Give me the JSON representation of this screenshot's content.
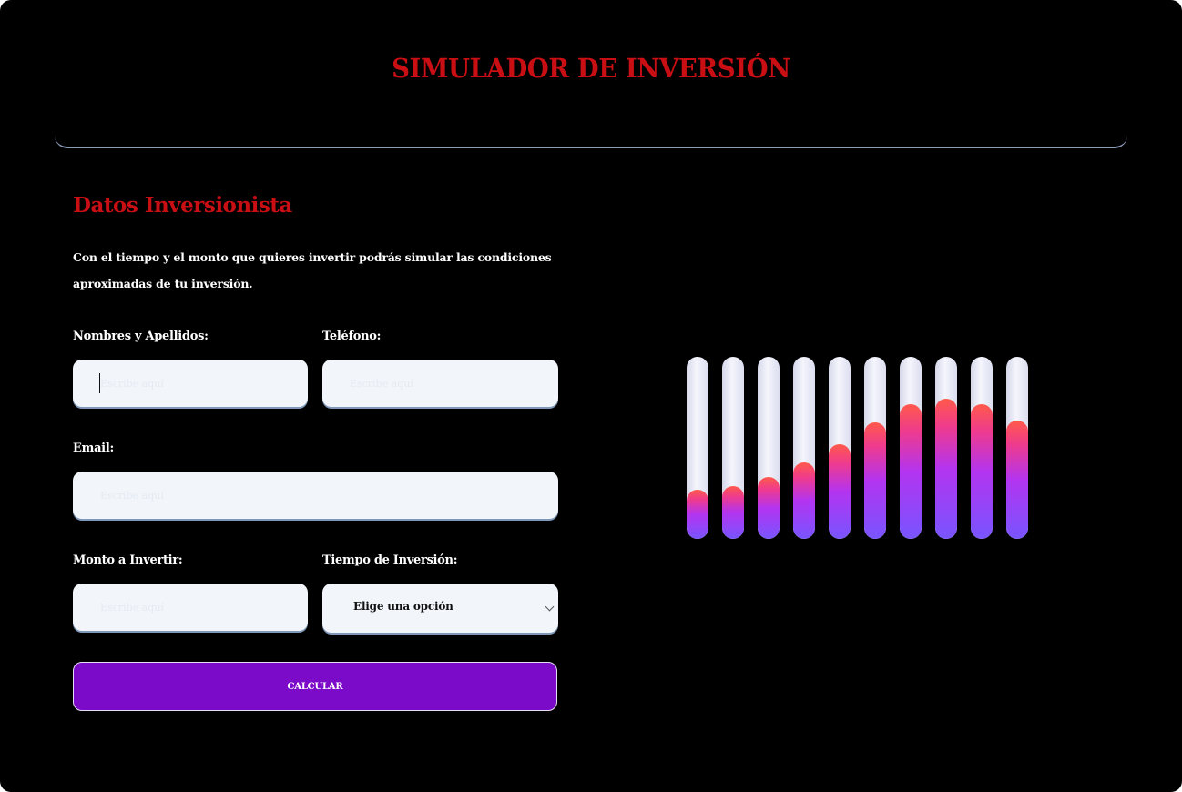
{
  "header": {
    "title": "SIMULADOR DE INVERSIÓN"
  },
  "form": {
    "section_title": "Datos Inversionista",
    "intro": "Con el tiempo y el monto que quieres invertir podrás simular las condiciones aproximadas de tu inversión.",
    "fields": {
      "nombres": {
        "label": "Nombres y Apellidos:",
        "placeholder": "Escribe aquí",
        "value": ""
      },
      "telefono": {
        "label": "Teléfono:",
        "placeholder": "Escribe aquí",
        "value": ""
      },
      "email": {
        "label": "Email:",
        "placeholder": "Escribe aquí",
        "value": ""
      },
      "monto": {
        "label": "Monto a Invertir:",
        "placeholder": "Escribe aquí",
        "value": ""
      },
      "tiempo": {
        "label": "Tiempo de Inversión:",
        "selected": "Elige una opción"
      }
    },
    "submit_label": "CALCULAR"
  },
  "bars": {
    "fill_fractions": [
      0.27,
      0.29,
      0.34,
      0.42,
      0.52,
      0.64,
      0.74,
      0.77,
      0.74,
      0.65
    ]
  },
  "colors": {
    "background": "#000000",
    "title": "#c90f14",
    "button": "#7b0bc8",
    "input_bg": "#f2f6fb",
    "bar_track": "#eceef8",
    "bar_fill_low": "#7855ff",
    "bar_fill_high": "#ff5a4a"
  }
}
